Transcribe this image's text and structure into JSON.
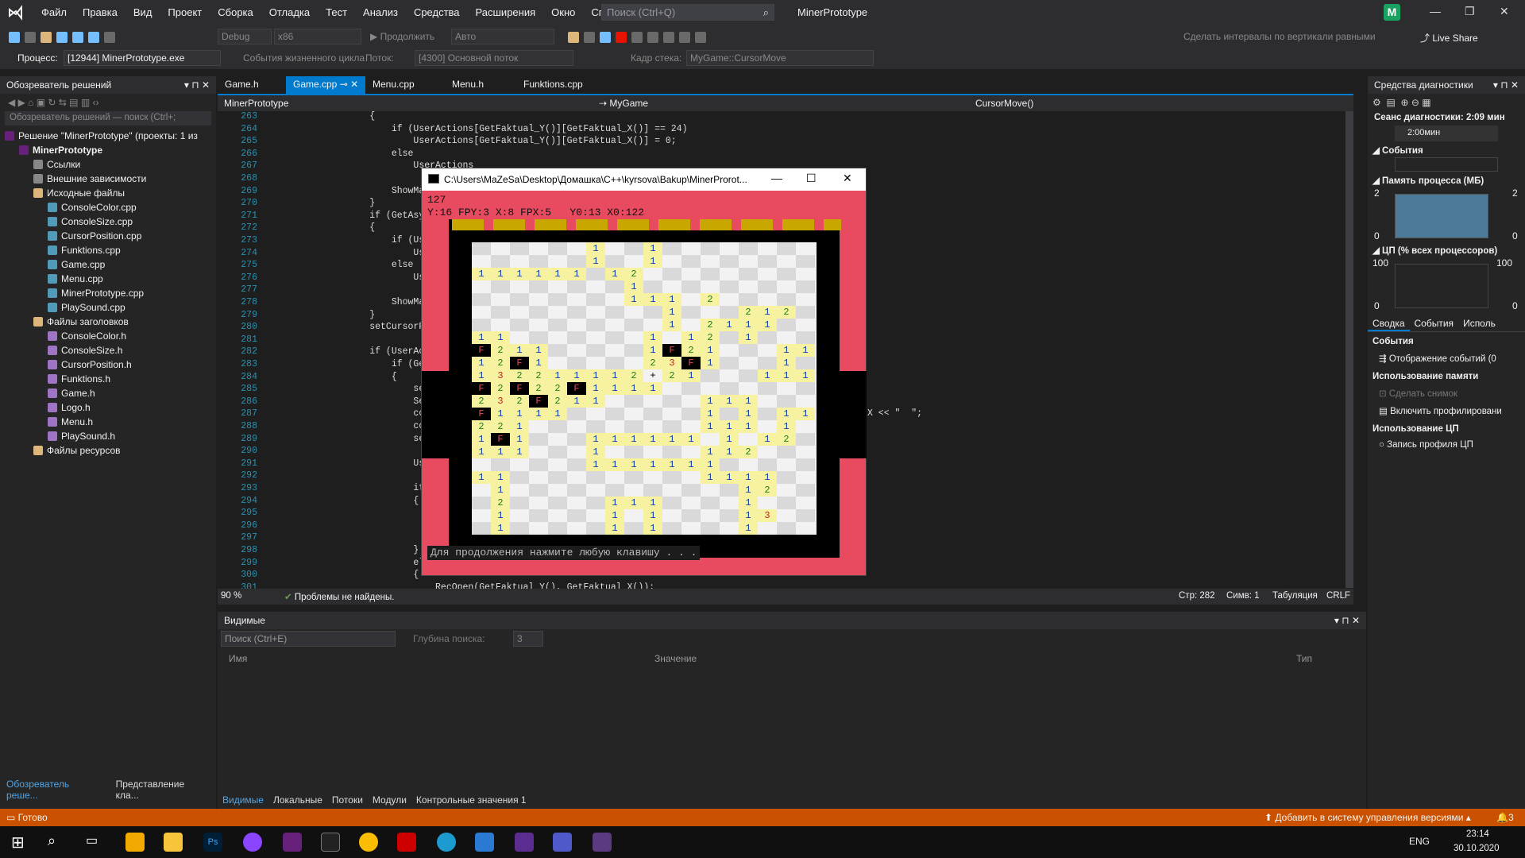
{
  "titlebar": {
    "menu": [
      "Файл",
      "Правка",
      "Вид",
      "Проект",
      "Сборка",
      "Отладка",
      "Тест",
      "Анализ",
      "Средства",
      "Расширения",
      "Окно",
      "Справка"
    ],
    "search_placeholder": "Поиск (Ctrl+Q)",
    "app_title": "MinerPrototype",
    "avatar": "M"
  },
  "toolbar1": {
    "config": "Debug",
    "platform": "x86",
    "continue": "Продолжить",
    "auto": "Авто",
    "align_label": "Сделать интервалы по вертикали равными",
    "live_share": "Live Share"
  },
  "toolbar2": {
    "process_label": "Процесс:",
    "process_value": "[12944] MinerPrototype.exe",
    "lifecycle": "События жизненного цикла",
    "thread_label": "Поток:",
    "thread_value": "[4300] Основной поток",
    "stack_label": "Кадр стека:",
    "stack_value": "MyGame::CursorMove"
  },
  "solution": {
    "title": "Обозреватель решений",
    "search": "Обозреватель решений — поиск (Ctrl+;",
    "items": [
      {
        "t": "Решение \"MinerPrototype\" (проекты: 1 из",
        "lvl": 0,
        "c": "#68217a"
      },
      {
        "t": "MinerPrototype",
        "lvl": 1,
        "c": "#68217a",
        "bold": true
      },
      {
        "t": "Ссылки",
        "lvl": 2,
        "c": "#888"
      },
      {
        "t": "Внешние зависимости",
        "lvl": 2,
        "c": "#888"
      },
      {
        "t": "Исходные файлы",
        "lvl": 2,
        "c": "#dcb67a"
      },
      {
        "t": "ConsoleColor.cpp",
        "lvl": 3,
        "c": "#519aba"
      },
      {
        "t": "ConsoleSize.cpp",
        "lvl": 3,
        "c": "#519aba"
      },
      {
        "t": "CursorPosition.cpp",
        "lvl": 3,
        "c": "#519aba"
      },
      {
        "t": "Funktions.cpp",
        "lvl": 3,
        "c": "#519aba"
      },
      {
        "t": "Game.cpp",
        "lvl": 3,
        "c": "#519aba"
      },
      {
        "t": "Menu.cpp",
        "lvl": 3,
        "c": "#519aba"
      },
      {
        "t": "MinerPrototype.cpp",
        "lvl": 3,
        "c": "#519aba"
      },
      {
        "t": "PlaySound.cpp",
        "lvl": 3,
        "c": "#519aba"
      },
      {
        "t": "Файлы заголовков",
        "lvl": 2,
        "c": "#dcb67a"
      },
      {
        "t": "ConsoleColor.h",
        "lvl": 3,
        "c": "#a074c4"
      },
      {
        "t": "ConsoleSize.h",
        "lvl": 3,
        "c": "#a074c4"
      },
      {
        "t": "CursorPosition.h",
        "lvl": 3,
        "c": "#a074c4"
      },
      {
        "t": "Funktions.h",
        "lvl": 3,
        "c": "#a074c4"
      },
      {
        "t": "Game.h",
        "lvl": 3,
        "c": "#a074c4"
      },
      {
        "t": "Logo.h",
        "lvl": 3,
        "c": "#a074c4"
      },
      {
        "t": "Menu.h",
        "lvl": 3,
        "c": "#a074c4"
      },
      {
        "t": "PlaySound.h",
        "lvl": 3,
        "c": "#a074c4"
      },
      {
        "t": "Файлы ресурсов",
        "lvl": 2,
        "c": "#dcb67a"
      }
    ],
    "bottom_tabs": [
      "Обозреватель реше...",
      "Представление кла..."
    ]
  },
  "tabs": [
    "Game.h",
    "Game.cpp",
    "Menu.cpp",
    "Menu.h",
    "Funktions.cpp"
  ],
  "nav": {
    "project": "MinerPrototype",
    "scope": "MyGame",
    "member": "CursorMove()"
  },
  "code": [
    {
      "n": "263",
      "t": "        {"
    },
    {
      "n": "264",
      "t": "            if (UserActions[GetFaktual_Y()][GetFaktual_X()] == 24)"
    },
    {
      "n": "265",
      "t": "                UserActions[GetFaktual_Y()][GetFaktual_X()] = 0;"
    },
    {
      "n": "266",
      "t": "            else"
    },
    {
      "n": "267",
      "t": "                UserActions"
    },
    {
      "n": "268",
      "t": ""
    },
    {
      "n": "269",
      "t": "            ShowMackFild();"
    },
    {
      "n": "270",
      "t": "        }"
    },
    {
      "n": "271",
      "t": "        if (GetAsyncKeyStat"
    },
    {
      "n": "272",
      "t": "        {"
    },
    {
      "n": "273",
      "t": "            if (UserActions"
    },
    {
      "n": "274",
      "t": "                UserActions"
    },
    {
      "n": "275",
      "t": "            else"
    },
    {
      "n": "276",
      "t": "                UserActions"
    },
    {
      "n": "277",
      "t": ""
    },
    {
      "n": "278",
      "t": "            ShowMackFild();"
    },
    {
      "n": "279",
      "t": "        }"
    },
    {
      "n": "280",
      "t": "        setCursorPosition(("
    },
    {
      "n": "281",
      "t": ""
    },
    {
      "n": "282",
      "t": "        if (UserActions[Get"
    },
    {
      "n": "283",
      "t": "            if (GetAsyncKey"
    },
    {
      "n": "284",
      "t": "            {"
    },
    {
      "n": "285",
      "t": "                setCursorPo"
    },
    {
      "n": "286",
      "t": "                SetColor(0,"
    },
    {
      "n": "287",
      "t": "                cout << \"Y:"
    },
    {
      "n": "288",
      "t": "                cout << \" \\"
    },
    {
      "n": "289",
      "t": "                setCursorPo"
    },
    {
      "n": "290",
      "t": ""
    },
    {
      "n": "291",
      "t": "                UserActions"
    },
    {
      "n": "292",
      "t": ""
    },
    {
      "n": "293",
      "t": "                if (Field[G"
    },
    {
      "n": "294",
      "t": "                {"
    },
    {
      "n": "295",
      "t": "                    Field[G"
    },
    {
      "n": "296",
      "t": "                    //Ups_E"
    },
    {
      "n": "297",
      "t": "                    RecOpe"
    },
    {
      "n": "298",
      "t": "                }"
    },
    {
      "n": "299",
      "t": "                else"
    },
    {
      "n": "300",
      "t": "                {"
    },
    {
      "n": "301",
      "t": "                    RecOpen(GetFaktual_Y(), GetFaktual_X());"
    }
  ],
  "code_tail_287": "X << \"  \";",
  "editor_status": {
    "zoom": "90 %",
    "problems": "Проблемы не найдены.",
    "line": "Стр: 282",
    "col": "Симв: 1",
    "tabs": "Табуляция",
    "eol": "CRLF"
  },
  "console": {
    "title": "C:\\Users\\MaZeSa\\Desktop\\Домашка\\C++\\kyrsova\\Bakup\\MinerProrot...",
    "line1": "127",
    "line2": "Y:16 FPY:3 X:8 FPX:5   Y0:13 X0:122",
    "footer": "Для продолжения нажмите любую клавишу . . .",
    "rows": [
      "      1  1       ",
      "      1  1       ",
      "111111 12       ",
      "        1       ",
      "        111 2   ",
      "          1   212",
      "          1 2111  111",
      "11       1 12 1  ",
      "F211     1F21   111",
      "12F1     23F1   1 1",
      "132211112+21   111",
      "F2F22F1111      ",
      "232F211     111 ",
      "F1111       1 1 111",
      "221         111 1",
      "1F1   111111 1 12",
      "111   1     112 ",
      "      1111111   ",
      "11          1111",
      " 1            12",
      " 2     111    1",
      " 1     1 1    13",
      " 1     1 1    1 "
    ]
  },
  "diag": {
    "title": "Средства диагностики",
    "session": "Сеанс диагностики: 2:09 мин",
    "time": "2:00мин",
    "events": "События",
    "memory": "Память процесса (МБ)",
    "mem_max": "2",
    "mem_min": "0",
    "cpu": "ЦП (% всех процессоров)",
    "cpu_max": "100",
    "cpu_min": "0",
    "tabs": [
      "Сводка",
      "События",
      "Исполь"
    ],
    "s_events": "События",
    "show_events": "Отображение событий (0",
    "s_memory": "Использование памяти",
    "snapshot": "Сделать снимок",
    "profiling": "Включить профилировани",
    "s_cpu": "Использование ЦП",
    "cpu_record": "Запись профиля ЦП"
  },
  "watch": {
    "title": "Видимые",
    "search": "Поиск (Ctrl+E)",
    "depth_label": "Глубина поиска:",
    "depth": "3",
    "cols": [
      "Имя",
      "Значение",
      "Тип"
    ],
    "bottom_tabs": [
      "Видимые",
      "Локальные",
      "Потоки",
      "Модули",
      "Контрольные значения 1"
    ]
  },
  "status": {
    "ready": "Готово",
    "vcs": "Добавить в систему управления версиями",
    "notif": "3"
  },
  "taskbar": {
    "lang": "ENG",
    "time": "23:14",
    "date": "30.10.2020"
  }
}
